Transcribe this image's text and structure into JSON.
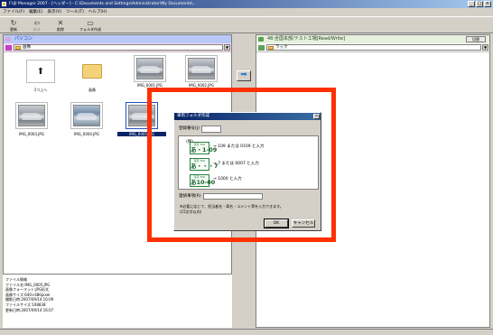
{
  "window": {
    "title": "FUJI Manager 2007 - [ヘッダー] - C:\\Documents and Settings\\Administrator\\My Documents\\..."
  },
  "menu": [
    "ファイル(F)",
    "編集(E)",
    "表示(V)",
    "ツール(T)",
    "ヘルプ(H)"
  ],
  "toolbar": [
    {
      "label": "更新",
      "icon": "↻",
      "disabled": false
    },
    {
      "label": "戻る",
      "icon": "⇦",
      "disabled": true
    },
    {
      "label": "削除",
      "icon": "✕",
      "disabled": false
    },
    {
      "label": "フォルダ作成",
      "icon": "▭",
      "disabled": false
    }
  ],
  "left_pane": {
    "title": "パソコン",
    "path": "画像",
    "items": [
      {
        "label": "1つ上へ",
        "kind": "up"
      },
      {
        "label": "画像",
        "kind": "folder"
      },
      {
        "label": "IMG_0001.JPG",
        "kind": "car"
      },
      {
        "label": "IMG_0002.JPG",
        "kind": "car"
      },
      {
        "label": "IMG_0003.JPG",
        "kind": "car"
      },
      {
        "label": "IMG_0004.JPG",
        "kind": "car-blue"
      },
      {
        "label": "IMG_0005.JPG",
        "kind": "car-selected"
      }
    ],
    "info": [
      "ファイル情報",
      "ファイル名:IMG_0005.JPG",
      "画像フォーマット:JPG形式",
      "画像サイズ:640×480pixel",
      "撮影日時:2007/09/14 16:09",
      "ファイルサイズ:108838",
      "更新日時:2007/09/14 16:07"
    ]
  },
  "right_pane": {
    "title": "48:全国本部/テスト工場[Read/Write]",
    "switch_button": "切替",
    "path": "ラック"
  },
  "dialog": {
    "title": "車両フォルダ作成",
    "reg_label": "登録番号(J)",
    "example_label": "(例)",
    "examples": [
      {
        "plate_region": "東京 500",
        "plate_number": "あ・1-09",
        "desc": "→ 109 または 0109 と入力"
      },
      {
        "plate_region": "東京 500",
        "plate_number": "あ・・・7",
        "desc": "→ 7 または 0007 と入力"
      },
      {
        "plate_region": "東京 500",
        "plate_number": "あ10-00",
        "desc": "→ 1000 と入力"
      }
    ],
    "contact_label": "連絡事項(R)",
    "note_lines": [
      "※必要に応じて、担当者名・車名・コメント等を入力できます。",
      "(15文字以内)"
    ],
    "ok_label": "OK",
    "cancel_label": "キャンセル"
  },
  "colors": {
    "highlight": "#ff3000",
    "titlebar": "#0a246a",
    "plate_green": "#2a8040"
  }
}
